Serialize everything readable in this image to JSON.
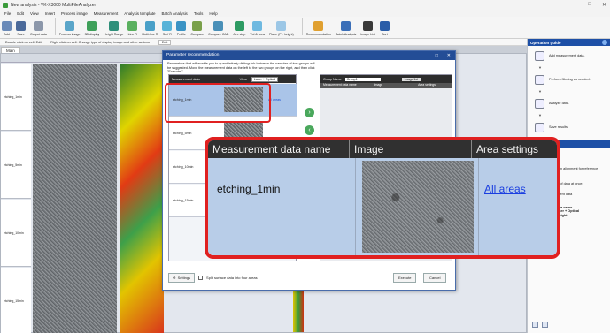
{
  "window": {
    "title": "New analysis - VK-X3000 MultiFileAnalyzer"
  },
  "menu": [
    "File",
    "Edit",
    "View",
    "Insert",
    "Process image",
    "Measurement",
    "Analysis template",
    "Batch Analysis",
    "Tools",
    "Help"
  ],
  "ribbon": [
    "Add",
    "Save",
    "Output data",
    "Process image",
    "3D display",
    "Height Range",
    "Line R",
    "Multi-line R",
    "Surf R",
    "Profile",
    "Compare",
    "Compare CAD",
    "Ave step",
    "Vol & area",
    "Plane (Pt. height)",
    "Recommendation",
    "Batch Analysis",
    "Image List",
    "Sort"
  ],
  "hints": {
    "double_click": "Double click on cell: Edit",
    "right_click": "Right click on cell: Change type of display image and other actions",
    "edit_button": "Edit"
  },
  "main_tab": "Main",
  "grid": {
    "row_labels": [
      "etching_1min",
      "etching_5min",
      "etching_10min",
      "etching_15min"
    ]
  },
  "dialog": {
    "title": "Parameter recommendation",
    "description": "Parameters that will enable you to quantitatively distinguish between the samples of two groups will be suggested. Move the measurement data on the left to the two groups on the right, and then click \"Execute.\"",
    "left": {
      "header": "Measurement data",
      "view_label": "View",
      "view_value": "Laser + Optical",
      "rows": [
        {
          "name": "etching_1min",
          "link": "All areas"
        },
        {
          "name": "etching_5min",
          "link": ""
        },
        {
          "name": "etching_10min",
          "link": ""
        },
        {
          "name": "etching_15min",
          "link": ""
        }
      ]
    },
    "group": {
      "name_label": "Group Name",
      "name_value": "Group1",
      "image_list": "Image list",
      "columns": [
        "Measurement data name",
        "Image",
        "Area settings"
      ]
    },
    "settings": "Settings",
    "split": "Split surface data into four areas",
    "execute": "Execute",
    "cancel": "Cancel"
  },
  "zoom": {
    "col1": "Measurement data name",
    "col2": "Image",
    "col3": "Area settings",
    "name": "etching_1min",
    "link": "All areas"
  },
  "right_panel": {
    "guide_title": "Operation guide",
    "steps": [
      "Add measurement data.",
      "Perform filtering as needed.",
      "Analyze data.",
      "Save results."
    ],
    "batch_title": "Batch analysis",
    "batch_lines": [
      "position alignment for reference",
      "batch of data at once.",
      "surement data"
    ],
    "bold_lines": [
      "ed data name",
      "r - Laser + Optical",
      "t2 - Height",
      "e",
      "late"
    ]
  }
}
